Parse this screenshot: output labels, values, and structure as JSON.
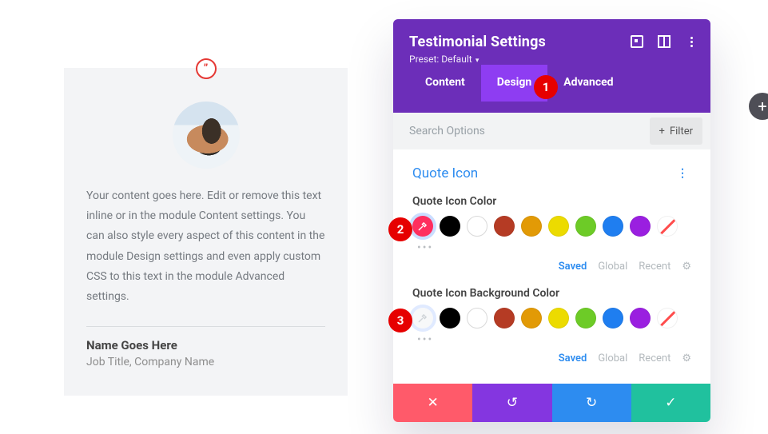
{
  "preview": {
    "quote_glyph": "”",
    "body": "Your content goes here. Edit or remove this text inline or in the module Content settings. You can also style every aspect of this content in the module Design settings and even apply custom CSS to this text in the module Advanced settings.",
    "author_name": "Name Goes Here",
    "author_meta": "Job Title, Company Name"
  },
  "panel": {
    "title": "Testimonial Settings",
    "preset_prefix": "Preset: ",
    "preset_value": "Default",
    "tabs": {
      "content": "Content",
      "design": "Design",
      "advanced": "Advanced",
      "active": "design"
    },
    "search_placeholder": "Search Options",
    "filter_label": "Filter",
    "section_title": "Quote Icon",
    "fields": {
      "icon_color": {
        "label": "Quote Icon Color",
        "active_swatch": "#ff2e5e"
      },
      "icon_bg": {
        "label": "Quote Icon Background Color",
        "active_swatch": "#ffffff"
      }
    },
    "preset_links": {
      "saved": "Saved",
      "global": "Global",
      "recent": "Recent"
    },
    "footer": {
      "cancel": "✕",
      "undo": "↺",
      "redo": "↻",
      "ok": "✓"
    }
  },
  "palette": [
    "#000000",
    "#ffffff",
    "#b53b24",
    "#e29a06",
    "#ecdb00",
    "#6dcb27",
    "#1f7ef0",
    "#9a1fe0",
    "striped"
  ],
  "callouts": {
    "1": "1",
    "2": "2",
    "3": "3"
  }
}
